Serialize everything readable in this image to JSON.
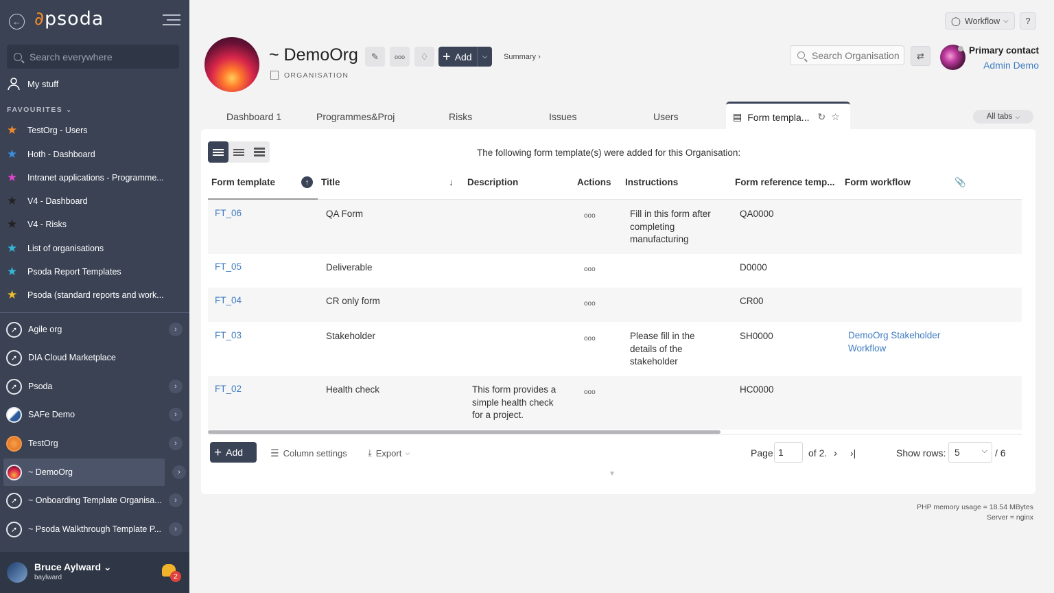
{
  "sidebar": {
    "logo": "psoda",
    "search_placeholder": "Search everywhere",
    "my_stuff": "My stuff",
    "favourites_header": "FAVOURITES",
    "favourites": [
      {
        "label": "TestOrg - Users",
        "color": "#f0892b"
      },
      {
        "label": "Hoth - Dashboard",
        "color": "#3a8fe0"
      },
      {
        "label": "Intranet applications - Programme...",
        "color": "#d946c9"
      },
      {
        "label": "V4 - Dashboard",
        "color": "#222222"
      },
      {
        "label": "V4 - Risks",
        "color": "#222222"
      },
      {
        "label": "List of organisations",
        "color": "#35b6d6"
      },
      {
        "label": "Psoda Report Templates",
        "color": "#35b6d6"
      },
      {
        "label": "Psoda (standard reports and work...",
        "color": "#f0c02b"
      }
    ],
    "orgs": [
      {
        "label": "Agile org"
      },
      {
        "label": "DIA Cloud Marketplace"
      },
      {
        "label": "Psoda"
      },
      {
        "label": "SAFe Demo"
      },
      {
        "label": "TestOrg"
      },
      {
        "label": "~ DemoOrg"
      },
      {
        "label": "~ Onboarding Template Organisa..."
      },
      {
        "label": "~ Psoda Walkthrough Template P..."
      }
    ],
    "user": {
      "name": "Bruce Aylward",
      "username": "baylward",
      "notifications": "2"
    }
  },
  "header": {
    "workflow_btn": "Workflow",
    "help_btn": "?",
    "org_title": "~ DemoOrg",
    "org_type": "ORGANISATION",
    "add_btn": "Add",
    "summary_link": "Summary ›",
    "search_placeholder": "Search Organisation",
    "primary_contact_label": "Primary contact",
    "primary_contact_name": "Admin Demo"
  },
  "tabs": {
    "items": [
      "Dashboard 1",
      "Programmes&Proj",
      "Risks",
      "Issues",
      "Users"
    ],
    "active": "Form templa...",
    "all_tabs": "All tabs"
  },
  "table": {
    "caption": "The following form template(s) were added for this Organisation:",
    "columns": [
      "Form template",
      "Title",
      "Description",
      "Actions",
      "Instructions",
      "Form reference temp...",
      "Form workflow"
    ],
    "rows": [
      {
        "id": "FT_06",
        "title": "QA Form",
        "description": "",
        "actions": "ooo",
        "instructions": [
          "Fill in this form after",
          "completing",
          "manufacturing"
        ],
        "ref": "QA0000",
        "workflow": []
      },
      {
        "id": "FT_05",
        "title": "Deliverable",
        "description": "",
        "actions": "ooo",
        "instructions": [],
        "ref": "D0000",
        "workflow": []
      },
      {
        "id": "FT_04",
        "title": "CR only form",
        "description": "",
        "actions": "ooo",
        "instructions": [],
        "ref": "CR00",
        "workflow": []
      },
      {
        "id": "FT_03",
        "title": "Stakeholder",
        "description": "",
        "actions": "ooo",
        "instructions": [
          "Please fill in the",
          "details of the",
          "stakeholder"
        ],
        "ref": "SH0000",
        "workflow": [
          "DemoOrg Stakeholder",
          "Workflow"
        ]
      },
      {
        "id": "FT_02",
        "title": "Health check",
        "description": [
          "This form provides a",
          "simple health check",
          "for a project."
        ],
        "actions": "ooo",
        "instructions": [],
        "ref": "HC0000",
        "workflow": []
      }
    ]
  },
  "footer": {
    "add_btn": "Add",
    "column_settings": "Column settings",
    "export": "Export",
    "page_label": "Page",
    "page_value": "1",
    "of_pages": "of 2.",
    "show_rows_label": "Show rows:",
    "rows_value": "5",
    "total": "/ 6",
    "php_memory": "PHP memory usage = 18.54 MBytes",
    "server": "Server = nginx"
  }
}
